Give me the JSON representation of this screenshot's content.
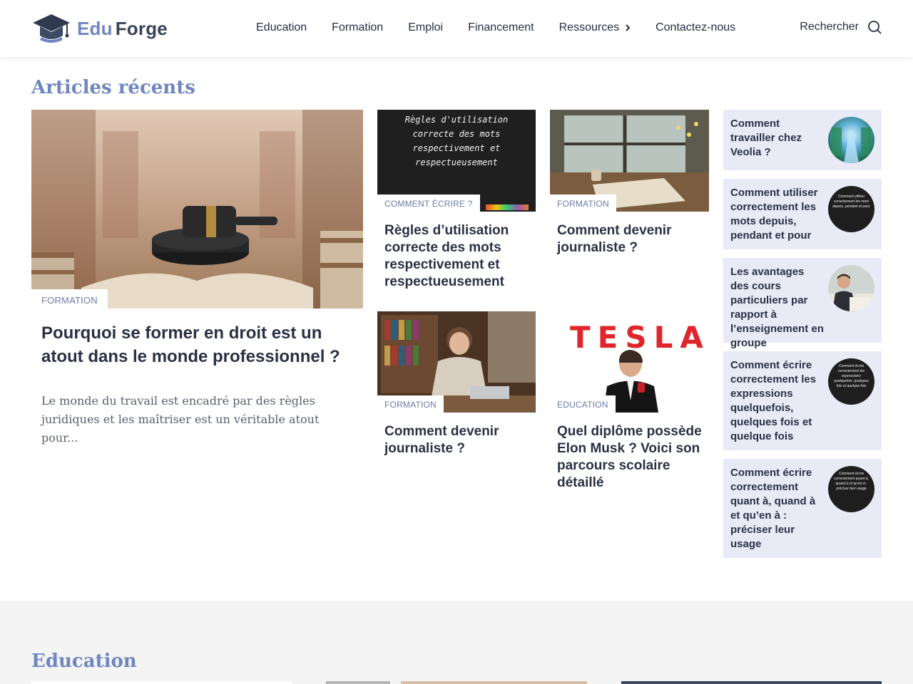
{
  "header": {
    "logo_edu": "Edu",
    "logo_forge": "Forge",
    "nav": [
      "Education",
      "Formation",
      "Emploi",
      "Financement",
      "Ressources",
      "Contactez-nous"
    ],
    "search_label": "Rechercher"
  },
  "recent": {
    "title": "Articles récents",
    "featured": {
      "category": "FORMATION",
      "title": "Pourquoi se former en droit est un atout dans le monde professionnel ?",
      "excerpt": "Le monde du travail est encadré par des règles juridiques et les maîtriser est un véritable atout pour..."
    },
    "cards": [
      {
        "category": "COMMENT ÉCRIRE ?",
        "title": "Règles d’utilisation correcte des mots respectivement et respectueusement",
        "image_text": "Règles d'utilisation correcte des mots respectivement et respectueusement"
      },
      {
        "category": "FORMATION",
        "title": "Comment devenir journaliste ?"
      },
      {
        "category": "FORMATION",
        "title": "Comment devenir journaliste ?"
      },
      {
        "category": "EDUCATION",
        "title": "Quel diplôme possède Elon Musk ? Voici son parcours scolaire détaillé",
        "image_text": "TESLA"
      }
    ],
    "sidebar": [
      {
        "title": "Comment travailler chez Veolia ?"
      },
      {
        "title": "Comment utiliser correctement les mots depuis, pendant et pour",
        "avatar_text": "Comment utiliser correctement les mots depuis, pendant et pour"
      },
      {
        "title": "Les avantages des cours particuliers par rapport à l’enseignement en groupe"
      },
      {
        "title": "Comment écrire correctement les expressions quelquefois, quelques fois et quelque fois",
        "avatar_text": "Comment écrire correctement les expressions quelquefois, quelques fois et quelque fois"
      },
      {
        "title": "Comment écrire correctement quant à, quand à et qu’en à : préciser leur usage",
        "avatar_text": "Comment écrire correctement quant à, quand à et qu'en à : préciser leur usage"
      }
    ]
  },
  "education": {
    "title": "Education"
  },
  "colors": {
    "accent": "#7086c0",
    "sidebar_bg": "#e8eaf6",
    "text_dark": "#2a3144"
  }
}
